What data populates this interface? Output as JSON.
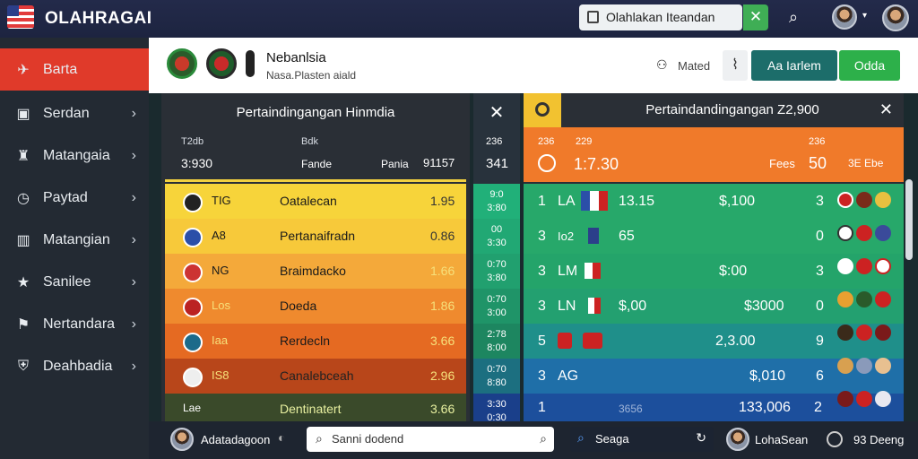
{
  "app": {
    "title": "OLAHRAGAI"
  },
  "search": {
    "value": "Olahlakan Iteandan",
    "clear_label": "✕"
  },
  "sidebar": {
    "items": [
      {
        "label": "Barta",
        "icon": "bird-icon",
        "active": true
      },
      {
        "label": "Serdan",
        "icon": "briefcase-icon"
      },
      {
        "label": "Matangaia",
        "icon": "trophy-icon"
      },
      {
        "label": "Paytad",
        "icon": "clock-icon"
      },
      {
        "label": "Matangian",
        "icon": "calendar-icon"
      },
      {
        "label": "Sanilee",
        "icon": "star-icon"
      },
      {
        "label": "Nertandara",
        "icon": "bell-icon"
      },
      {
        "label": "Deahbadia",
        "icon": "shield-icon"
      }
    ]
  },
  "header": {
    "name": "Nebanlsia",
    "sub": "Nasa.Plasten aiald",
    "match_label": "Mated",
    "btn_primary": "Aa Iarlem",
    "btn_secondary": "Odda"
  },
  "left_panel": {
    "title": "Pertaindingangan Hinmdia",
    "col1_top": "T2db",
    "col1_bottom": "3:930",
    "col2_top": "Bdk",
    "col2_bottom": "Fande",
    "col3": "Pania",
    "col4": "91157",
    "rows": [
      {
        "code": "TIG",
        "name": "Oatalecan",
        "val": "1.95",
        "bg": "#f7d43a",
        "badge": "#222"
      },
      {
        "code": "A8",
        "name": "Pertanaifradn",
        "val": "0.86",
        "bg": "#f7c93a",
        "badge": "#2b4fa8"
      },
      {
        "code": "NG",
        "name": "Braimdacko",
        "val": "1.66",
        "bg": "#f4a93a",
        "badge": "#c33"
      },
      {
        "code": "Los",
        "name": "Doeda",
        "val": "1.86",
        "bg": "#ef8a2e",
        "badge": "#b22"
      },
      {
        "code": "Iaa",
        "name": "Rerdecln",
        "val": "3.66",
        "bg": "#e56a22",
        "badge": "#1c6a8a"
      },
      {
        "code": "IS8",
        "name": "Canalebceah",
        "val": "2.96",
        "bg": "#b8461a",
        "badge": "#eee"
      },
      {
        "code": "Lae",
        "name": "Dentinatert",
        "val": "3.66",
        "bg": "#3a4a2a",
        "badge": "#c8b38a"
      }
    ]
  },
  "mid_col": {
    "head_top": "236",
    "head_bottom": "341",
    "cells": [
      [
        "9:0",
        "3:80"
      ],
      [
        "00",
        "3:30"
      ],
      [
        "0:70",
        "3:80"
      ],
      [
        "0:70",
        "3:00"
      ],
      [
        "2:78",
        "8:00"
      ],
      [
        "0:70",
        "8:80"
      ],
      [
        "3:30",
        "0:30"
      ]
    ]
  },
  "right_panel": {
    "title": "Pertaindandingangan Z2,900",
    "col_a": "236",
    "col_b": "229",
    "col_c": "236",
    "head_val": "1:7.30",
    "head_fees": "Fees",
    "head_num": "50",
    "head_right": "3E Ebe",
    "rows": [
      {
        "rank": "1",
        "code": "LA",
        "v1": "13.15",
        "v2": "$,100",
        "n": "3",
        "bg": "#27a86a"
      },
      {
        "rank": "3",
        "code": "Io2",
        "v1": "65",
        "v2": "",
        "n": "0",
        "bg": "#27a86a"
      },
      {
        "rank": "3",
        "code": "LM",
        "v1": "",
        "v2": "$:00",
        "n": "3",
        "bg": "#24a46a"
      },
      {
        "rank": "3",
        "code": "LN",
        "v1": "$,00",
        "v2": "$3000",
        "n": "0",
        "bg": "#23a070"
      },
      {
        "rank": "5",
        "code": "",
        "v1": "",
        "v2": "2,3.00",
        "n": "9",
        "bg": "#1f8f8a"
      },
      {
        "rank": "3",
        "code": "AG",
        "v1": "",
        "v2": "$,010",
        "n": "6",
        "bg": "#1f6fa8"
      },
      {
        "rank": "1",
        "code": "",
        "v1": "3656",
        "v2": "133,006",
        "n": "2",
        "bg": "#1c4f9c"
      }
    ]
  },
  "bottom": {
    "user1": "Adatadagoon",
    "search_placeholder": "Sanni dodend",
    "search2": "Seaga",
    "user2": "LohaSean",
    "right_label": "93 Deeng"
  }
}
